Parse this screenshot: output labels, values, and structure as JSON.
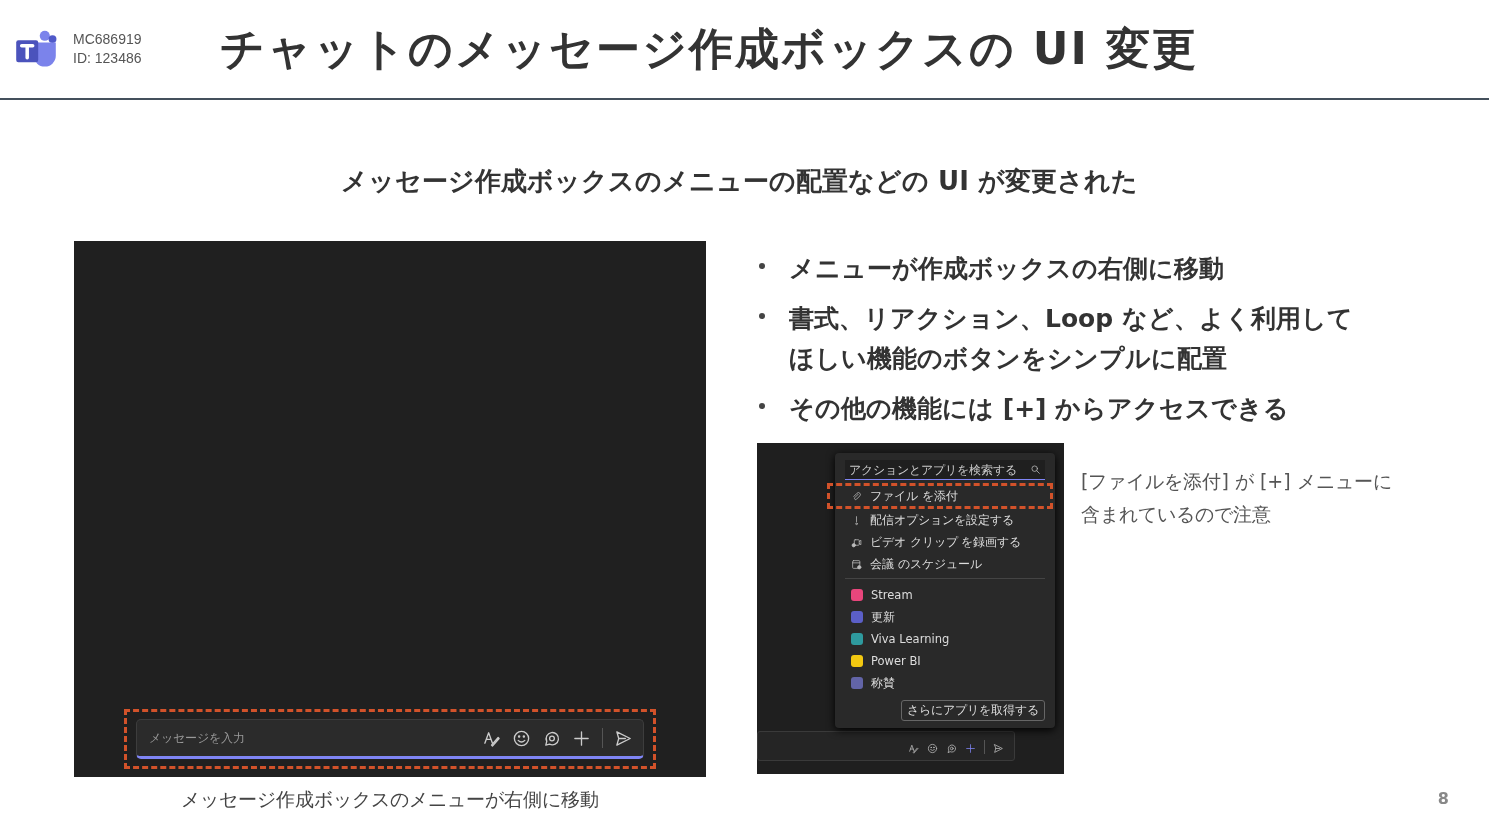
{
  "header": {
    "code": "MC686919",
    "id": "ID: 123486",
    "title": "チャットのメッセージ作成ボックスの UI 変更"
  },
  "subtitle": "メッセージ作成ボックスのメニューの配置などの UI が変更された",
  "main_screenshot": {
    "compose": {
      "placeholder": "メッセージを入力"
    }
  },
  "caption": "メッセージ作成ボックスのメニューが右側に移動",
  "bullets": [
    "メニューが作成ボックスの右側に移動",
    [
      "書式、リアクション、Loop など、よく利用して",
      "ほしい機能のボタンをシンプルに配置"
    ],
    "その他の機能には [+] からアクセスできる"
  ],
  "menu_screenshot": {
    "menu_open": true,
    "search": {
      "placeholder": "アクションとアプリを検索する"
    },
    "actions": [
      {
        "label": "ファイル を添付",
        "kind": "clip",
        "highlighted": true
      },
      {
        "label": "配信オプションを設定する",
        "kind": "bulb",
        "highlighted": false
      },
      {
        "label": "ビデオ クリップ を録画する",
        "kind": "video",
        "highlighted": false
      },
      {
        "label": "会議 のスケジュール",
        "kind": "calendar",
        "highlighted": false
      }
    ],
    "apps": [
      {
        "label": "Stream",
        "color": "#e8467c"
      },
      {
        "label": "更新",
        "color": "#5b5fc7"
      },
      {
        "label": "Viva Learning",
        "color": "#2e9a9e"
      },
      {
        "label": "Power BI",
        "color": "#f2c811"
      },
      {
        "label": "称賛",
        "color": "#6264a7"
      }
    ],
    "more_button": "さらにアプリを取得する"
  },
  "note": [
    "[ファイルを添付] が [+] メニューに",
    "含まれているので注意"
  ],
  "page_number": "8"
}
